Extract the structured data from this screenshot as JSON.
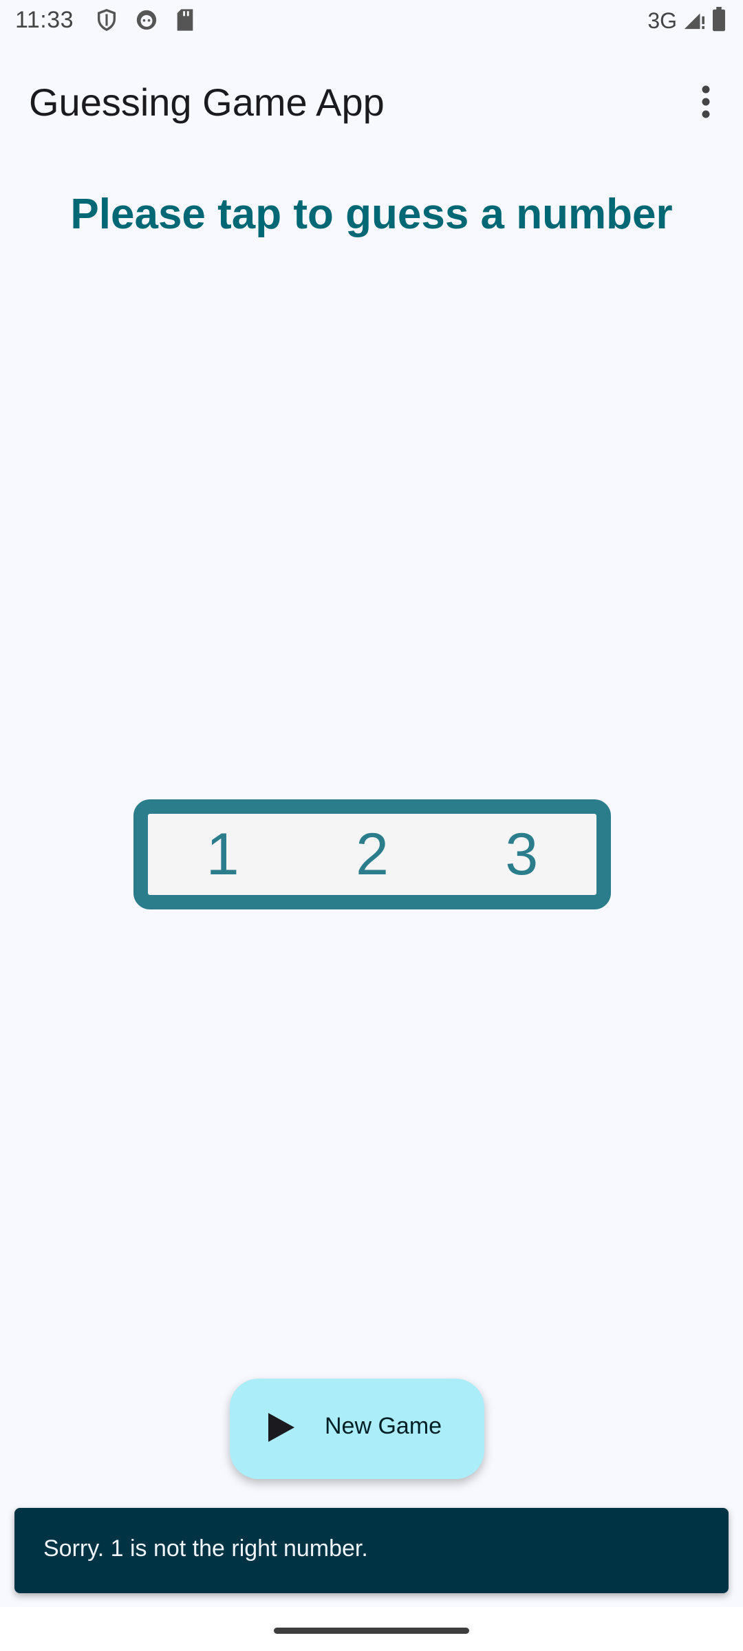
{
  "status_bar": {
    "time": "11:33",
    "network": "3G",
    "icons_left": [
      "shield-icon",
      "face-icon",
      "sd-card-icon"
    ],
    "icons_right": [
      "signal-icon",
      "battery-icon"
    ]
  },
  "app_bar": {
    "title": "Guessing Game App",
    "menu_icon": "more-vert-icon"
  },
  "prompt": "Please tap to guess a number",
  "numbers": [
    "1",
    "2",
    "3"
  ],
  "fab": {
    "label": "New Game",
    "icon": "play-icon"
  },
  "snackbar": {
    "message": "Sorry. 1 is not the right number."
  },
  "colors": {
    "accent": "#006874",
    "picker_border": "#2b7d8c",
    "fab_background": "#acedfa",
    "snackbar_background": "#003344"
  }
}
